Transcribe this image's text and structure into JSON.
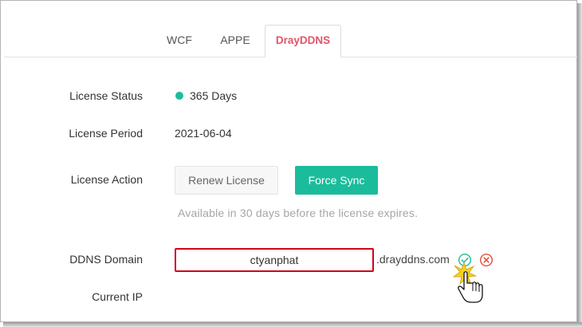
{
  "tabs": [
    {
      "label": "WCF",
      "active": false
    },
    {
      "label": "APPE",
      "active": false
    },
    {
      "label": "DrayDDNS",
      "active": true
    }
  ],
  "license_status": {
    "label": "License Status",
    "value": "365 Days",
    "status_color": "#1bbc9b"
  },
  "license_period": {
    "label": "License Period",
    "value": "2021-06-04"
  },
  "license_action": {
    "label": "License Action",
    "renew_label": "Renew License",
    "sync_label": "Force Sync",
    "hint": "Available in 30 days before the license expires."
  },
  "ddns_domain": {
    "label": "DDNS Domain",
    "value": "ctyanphat",
    "suffix": ".drayddns.com"
  },
  "current_ip": {
    "label": "Current IP"
  },
  "colors": {
    "accent": "#1bbc9b",
    "active_tab": "#e0556a",
    "error": "#d0021b",
    "cancel": "#e74c3c"
  },
  "icons": {
    "confirm": "check-circle-icon",
    "cancel": "x-circle-icon",
    "pointer": "hand-pointer-icon"
  }
}
